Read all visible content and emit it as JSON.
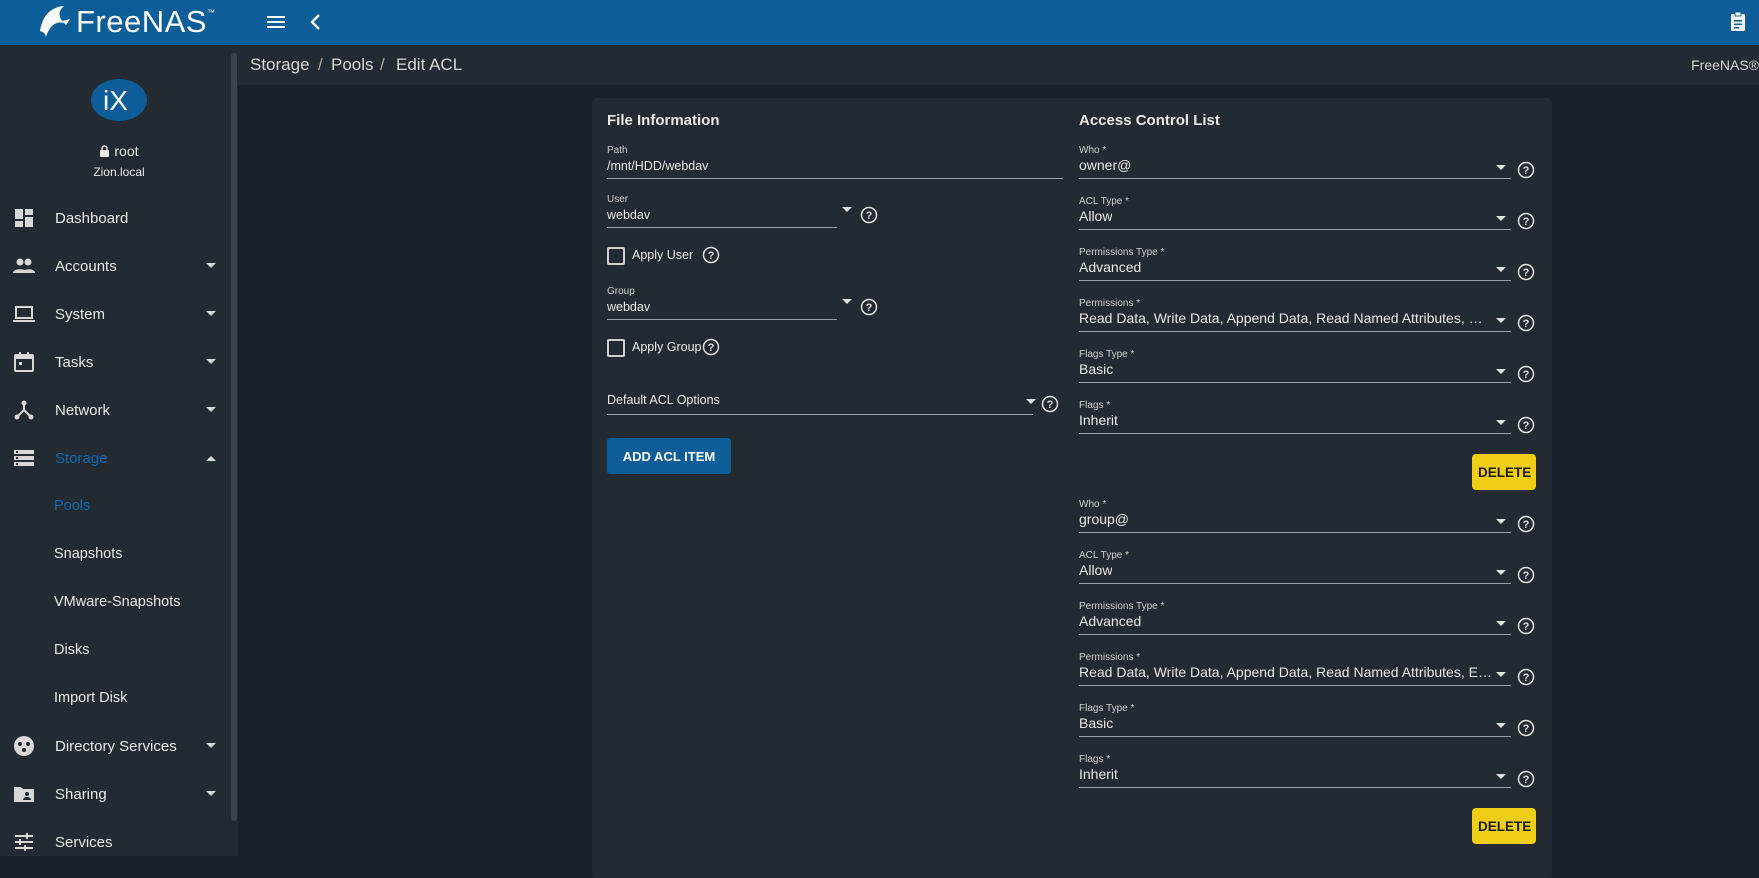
{
  "header": {
    "logo_text": "FreeNAS",
    "logo_tm": "™"
  },
  "profile": {
    "username": "root",
    "hostname": "Zion.local"
  },
  "sidebar": {
    "items": [
      {
        "label": "Dashboard"
      },
      {
        "label": "Accounts"
      },
      {
        "label": "System"
      },
      {
        "label": "Tasks"
      },
      {
        "label": "Network"
      },
      {
        "label": "Storage"
      },
      {
        "label": "Directory Services"
      },
      {
        "label": "Sharing"
      },
      {
        "label": "Services"
      }
    ],
    "storage_sub": [
      {
        "label": "Pools"
      },
      {
        "label": "Snapshots"
      },
      {
        "label": "VMware-Snapshots"
      },
      {
        "label": "Disks"
      },
      {
        "label": "Import Disk"
      }
    ]
  },
  "breadcrumb": {
    "items": [
      "Storage",
      "Pools",
      "Edit ACL"
    ],
    "separator": "/",
    "brand_right": "FreeNAS®"
  },
  "file_info": {
    "title": "File Information",
    "path_label": "Path",
    "path_value": "/mnt/HDD/webdav",
    "user_label": "User",
    "user_value": "webdav",
    "apply_user_label": "Apply User",
    "group_label": "Group",
    "group_value": "webdav",
    "apply_group_label": "Apply Group",
    "default_acl_label": "Default ACL Options",
    "add_button": "ADD ACL ITEM"
  },
  "acl": {
    "title": "Access Control List",
    "labels": {
      "who": "Who *",
      "acl_type": "ACL Type *",
      "perm_type": "Permissions Type *",
      "perms": "Permissions *",
      "flags_type": "Flags Type *",
      "flags": "Flags *"
    },
    "delete_label": "DELETE",
    "entries": [
      {
        "who": "owner@",
        "acl_type": "Allow",
        "perm_type": "Advanced",
        "perms": "Read Data, Write Data, Append Data, Read Named Attributes, Wri…",
        "flags_type": "Basic",
        "flags": "Inherit"
      },
      {
        "who": "group@",
        "acl_type": "Allow",
        "perm_type": "Advanced",
        "perms": "Read Data, Write Data, Append Data, Read Named Attributes, Exe…",
        "flags_type": "Basic",
        "flags": "Inherit"
      }
    ]
  },
  "colors": {
    "topbar": "#0d5e98",
    "accent": "#0e6ab0",
    "delete": "#f0ce16",
    "panel": "#232a31",
    "background": "#1a2027"
  },
  "icons": [
    "menu-icon",
    "back-chevron-icon",
    "clipboard-icon",
    "dashboard-icon",
    "accounts-icon",
    "laptop-icon",
    "calendar-icon",
    "network-icon",
    "storage-icon",
    "directory-services-icon",
    "sharing-icon",
    "services-icon",
    "help-icon",
    "lock-icon"
  ]
}
